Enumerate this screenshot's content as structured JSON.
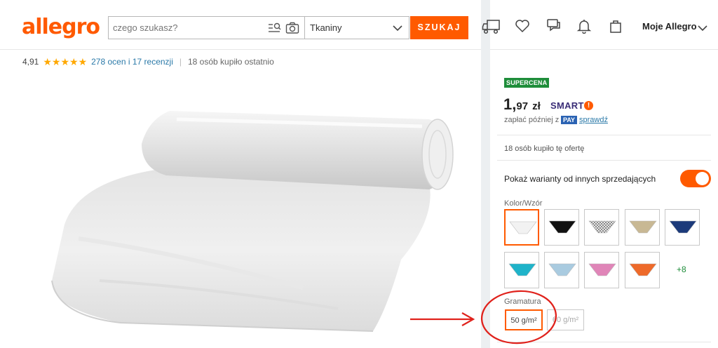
{
  "header": {
    "logo": "allegro",
    "search_placeholder": "czego szukasz?",
    "category": "Tkaniny",
    "search_button": "SZUKAJ",
    "account": "Moje Allegro"
  },
  "rating": {
    "score": "4,91",
    "stars": "★★★★★",
    "reviews": "278 ocen i 17 recenzji",
    "bought": "18 osób kupiło ostatnio"
  },
  "offer": {
    "badge": "SUPERCENA",
    "price_main": "1,",
    "price_cents": "97",
    "currency": "zł",
    "smart": "SMART",
    "smart_mark": "!",
    "pay_later_text": "zapłać później z",
    "pay_badge": "PAY",
    "check_link": "sprawdź",
    "bought_offer": "18 osób kupiło tę ofertę",
    "variants_toggle_label": "Pokaż warianty od innych sprzedających",
    "variants_toggle_on": true,
    "color_label": "Kolor/Wzór",
    "colors": [
      {
        "name": "white",
        "hex": "#f2f2f2"
      },
      {
        "name": "black",
        "hex": "#111111"
      },
      {
        "name": "grey-pattern",
        "hex": "#9a9a9a"
      },
      {
        "name": "beige",
        "hex": "#c8b894"
      },
      {
        "name": "navy",
        "hex": "#1c3a7a"
      },
      {
        "name": "turquoise",
        "hex": "#1fb3c9"
      },
      {
        "name": "light-blue",
        "hex": "#a9cbe0"
      },
      {
        "name": "pink",
        "hex": "#e085b8"
      },
      {
        "name": "orange",
        "hex": "#ee6a2a"
      }
    ],
    "more_colors": "+8",
    "weight_label": "Gramatura",
    "weights": [
      "50 g/m²",
      "60 g/m²"
    ]
  }
}
